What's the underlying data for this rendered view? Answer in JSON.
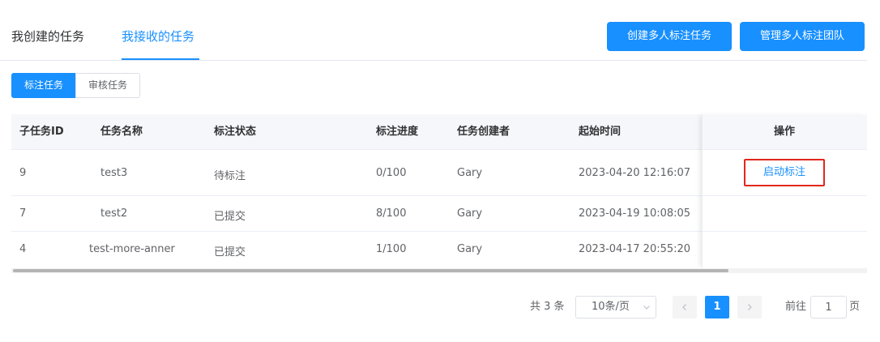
{
  "tabs": {
    "mine": "我创建的任务",
    "received": "我接收的任务"
  },
  "actions": {
    "create": "创建多人标注任务",
    "manage": "管理多人标注团队"
  },
  "segments": {
    "annotate": "标注任务",
    "review": "审核任务"
  },
  "table": {
    "headers": {
      "id": "子任务ID",
      "name": "任务名称",
      "status": "标注状态",
      "progress": "标注进度",
      "creator": "任务创建者",
      "start": "起始时间",
      "op": "操作"
    },
    "rows": [
      {
        "id": "9",
        "name": "test3",
        "status": "待标注",
        "progress": "0/100",
        "creator": "Gary",
        "start": "2023-04-20 12:16:07",
        "op": "启动标注"
      },
      {
        "id": "7",
        "name": "test2",
        "status": "已提交",
        "progress": "8/100",
        "creator": "Gary",
        "start": "2023-04-19 10:08:05",
        "op": ""
      },
      {
        "id": "4",
        "name": "test-more-anner",
        "status": "已提交",
        "progress": "1/100",
        "creator": "Gary",
        "start": "2023-04-17 20:55:20",
        "op": ""
      }
    ]
  },
  "pagination": {
    "total": "共 3 条",
    "page_size": "10条/页",
    "current": "1",
    "goto_label": "前往",
    "goto_value": "1",
    "page_label": "页"
  },
  "colors": {
    "primary": "#1890ff",
    "highlight_border": "#e0271d"
  }
}
